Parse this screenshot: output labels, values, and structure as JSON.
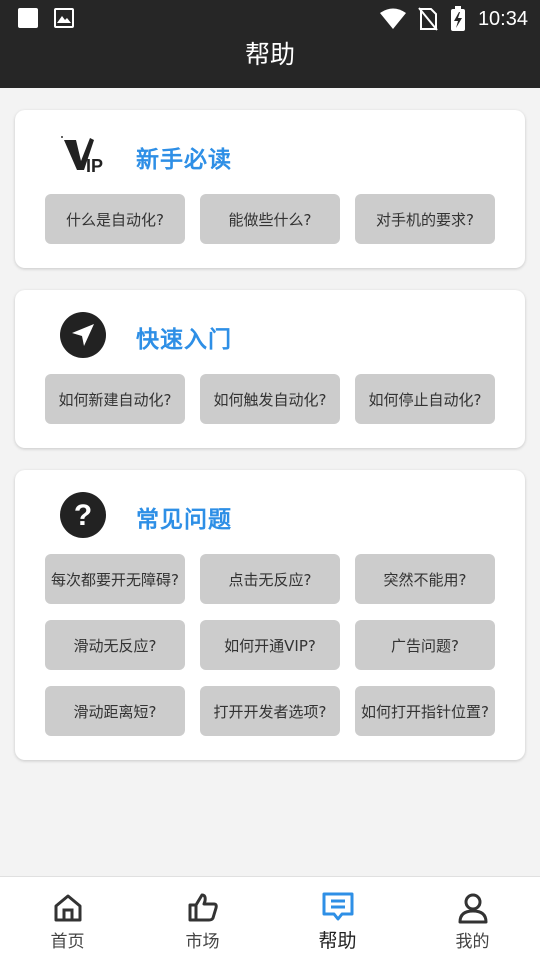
{
  "status_bar": {
    "time": "10:34"
  },
  "header": {
    "title": "帮助"
  },
  "sections": [
    {
      "title": "新手必读",
      "icon": "vip-icon",
      "items": [
        "什么是自动化?",
        "能做些什么?",
        "对手机的要求?"
      ]
    },
    {
      "title": "快速入门",
      "icon": "navigation-arrow-icon",
      "items": [
        "如何新建自动化?",
        "如何触发自动化?",
        "如何停止自动化?"
      ]
    },
    {
      "title": "常见问题",
      "icon": "question-icon",
      "items": [
        "每次都要开无障碍?",
        "点击无反应?",
        "突然不能用?",
        "滑动无反应?",
        "如何开通VIP?",
        "广告问题?",
        "滑动距离短?",
        "打开开发者选项?",
        "如何打开指针位置?"
      ]
    }
  ],
  "bottom_nav": [
    {
      "label": "首页",
      "icon": "home-icon",
      "active": false
    },
    {
      "label": "市场",
      "icon": "thumbs-up-icon",
      "active": false
    },
    {
      "label": "帮助",
      "icon": "help-chat-icon",
      "active": true
    },
    {
      "label": "我的",
      "icon": "user-icon",
      "active": false
    }
  ],
  "colors": {
    "accent": "#2e8fe6",
    "bar": "#262626",
    "chip": "#cccccc",
    "active_nav": "#2e8fe6"
  }
}
